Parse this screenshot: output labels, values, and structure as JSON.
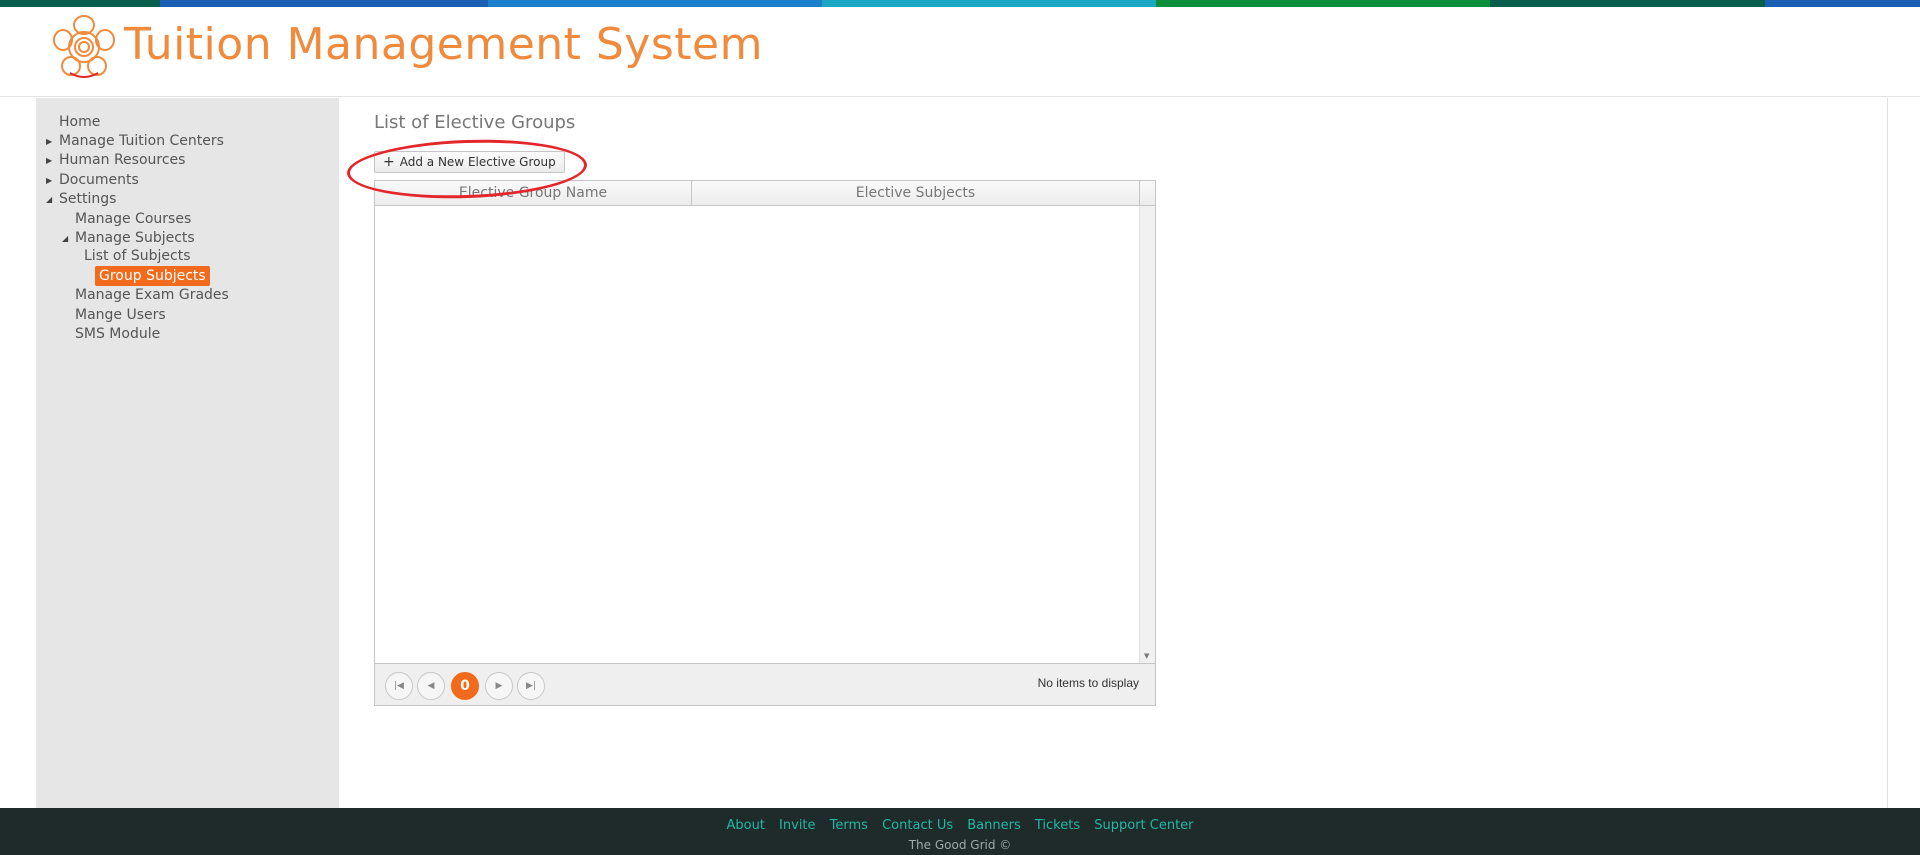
{
  "header": {
    "title": "Tuition Management System",
    "stripe_colors": [
      "#0a5e4e",
      "#1a5fb4",
      "#1b7fcc",
      "#1ba7c4",
      "#0c8f3c",
      "#0a5e4e",
      "#1a5fb4"
    ]
  },
  "sidebar": {
    "items": [
      {
        "label": "Home",
        "expander": "none",
        "active": false
      },
      {
        "label": "Manage Tuition Centers",
        "expander": "collapsed",
        "active": false
      },
      {
        "label": "Human Resources",
        "expander": "collapsed",
        "active": false
      },
      {
        "label": "Documents",
        "expander": "collapsed",
        "active": false
      },
      {
        "label": "Settings",
        "expander": "expanded",
        "active": false
      },
      {
        "label": "Manage Courses",
        "expander": "none",
        "active": false
      },
      {
        "label": "Manage Subjects",
        "expander": "expanded",
        "active": false
      },
      {
        "label": "List of Subjects",
        "expander": "none",
        "active": false
      },
      {
        "label": "Group Subjects",
        "expander": "none",
        "active": true
      },
      {
        "label": "Manage Exam Grades",
        "expander": "none",
        "active": false
      },
      {
        "label": "Mange Users",
        "expander": "none",
        "active": false
      },
      {
        "label": "SMS Module",
        "expander": "none",
        "active": false
      }
    ]
  },
  "main": {
    "page_title": "List of Elective Groups",
    "add_button_label": "Add a New Elective Group",
    "grid": {
      "columns": [
        "Elective Group Name",
        "Elective Subjects"
      ],
      "rows": [],
      "pager": {
        "current_page": "0",
        "info": "No items to display"
      }
    }
  },
  "footer": {
    "links": [
      "About",
      "Invite",
      "Terms",
      "Contact Us",
      "Banners",
      "Tickets",
      "Support Center"
    ],
    "copyright": "The Good Grid ©"
  },
  "colors": {
    "accent": "#f26a1b",
    "title": "#f08a3c",
    "footer_bg": "#1f2a2a",
    "footer_link": "#21b8a4",
    "highlight": "#e3262a"
  }
}
